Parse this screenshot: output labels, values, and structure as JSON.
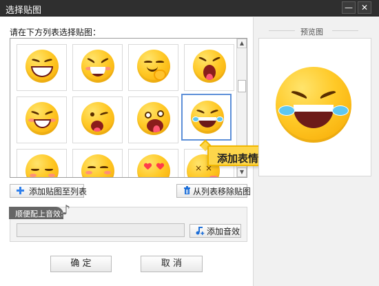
{
  "window": {
    "title": "选择贴图",
    "minimize_icon": "minimize-icon",
    "close_icon": "close-icon"
  },
  "left": {
    "instruction": "请在下方列表选择贴图：",
    "selected_sticker": "crying-laughing-face",
    "tooltip": "添加表情包"
  },
  "stickers": [
    {
      "name": "grinning-face"
    },
    {
      "name": "laughing-face"
    },
    {
      "name": "smirking-hand-face"
    },
    {
      "name": "surprised-face"
    },
    {
      "name": "playful-face"
    },
    {
      "name": "winking-tongue-face"
    },
    {
      "name": "crazy-tongue-face"
    },
    {
      "name": "crying-laughing-face"
    },
    {
      "name": "relieved-face"
    },
    {
      "name": "smiling-face"
    },
    {
      "name": "heart-eyes-face"
    },
    {
      "name": "dizzy-face"
    }
  ],
  "buttons": {
    "add_to_list": "添加贴图至列表",
    "remove_from_list": "从列表移除贴图",
    "add_sound": "添加音效",
    "confirm": "确 定",
    "cancel": "取 消"
  },
  "sound": {
    "label": "顺便配上音效:",
    "value": ""
  },
  "preview": {
    "label": "预览图"
  },
  "colors": {
    "titlebar": "#2f2f2f",
    "selection": "#5d8fd8",
    "tooltip": "#fdd64b",
    "accent_blue": "#2f80ed",
    "trash_blue": "#1c6ed8"
  }
}
